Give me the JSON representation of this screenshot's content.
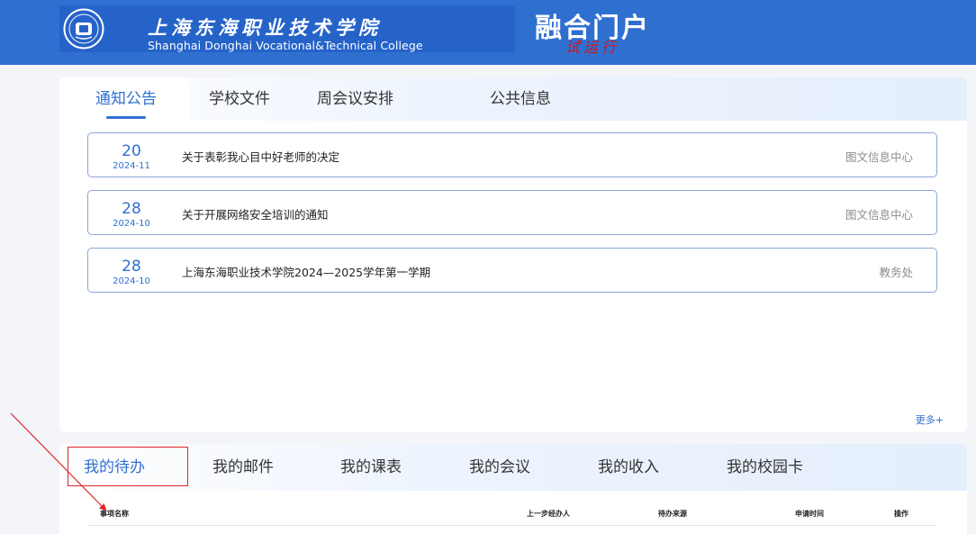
{
  "header": {
    "school_name_cn": "上海东海职业技术学院",
    "school_name_en": "Shanghai Donghai Vocational&Technical College",
    "portal_title": "融合门户",
    "badge": "试运行"
  },
  "notice_panel": {
    "tabs": [
      {
        "label": "通知公告",
        "active": true
      },
      {
        "label": "学校文件",
        "active": false
      },
      {
        "label": "周会议安排",
        "active": false
      },
      {
        "label": "公共信息",
        "active": false
      }
    ],
    "items": [
      {
        "day": "20",
        "year_month": "2024-11",
        "title": "关于表彰我心目中好老师的决定",
        "source": "图文信息中心"
      },
      {
        "day": "28",
        "year_month": "2024-10",
        "title": "关于开展网络安全培训的通知",
        "source": "图文信息中心"
      },
      {
        "day": "28",
        "year_month": "2024-10",
        "title": "上海东海职业技术学院2024—2025学年第一学期",
        "source": "教务处"
      }
    ],
    "more_label": "更多+"
  },
  "todo_panel": {
    "tabs": [
      {
        "label": "我的待办",
        "active": true
      },
      {
        "label": "我的邮件",
        "active": false
      },
      {
        "label": "我的课表",
        "active": false
      },
      {
        "label": "我的会议",
        "active": false
      },
      {
        "label": "我的收入",
        "active": false
      },
      {
        "label": "我的校园卡",
        "active": false
      }
    ],
    "columns": [
      "事项名称",
      "上一步经办人",
      "待办来源",
      "申请时间",
      "操作"
    ]
  },
  "colors": {
    "header_bg": "#2f6fd0",
    "accent": "#2f6fd0",
    "badge": "#d0161d",
    "annotation": "#e0252a"
  }
}
